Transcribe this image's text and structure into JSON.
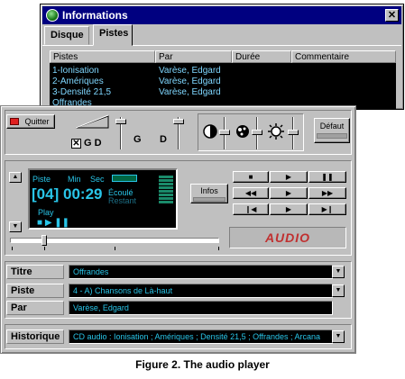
{
  "info_window": {
    "title": "Informations",
    "close_glyph": "✕",
    "tabs": [
      "Disque",
      "Pistes"
    ],
    "columns": [
      "Pistes",
      "Par",
      "Durée",
      "Commentaire"
    ],
    "rows": [
      {
        "piste": "1-Ionisation",
        "par": "Varèse, Edgard"
      },
      {
        "piste": "2-Amériques",
        "par": "Varèse, Edgard"
      },
      {
        "piste": "3-Densité 21,5",
        "par": "Varèse, Edgard"
      },
      {
        "piste": "Offrandes",
        "par": ""
      }
    ]
  },
  "controls": {
    "quit_label": "Quitter",
    "gd_label": "G D",
    "gd_checked": true,
    "check_glyph": "✕",
    "slider_g_label": "G",
    "slider_d_label": "D",
    "default_label": "Défaut"
  },
  "display": {
    "piste_label": "Piste",
    "min_label": "Min",
    "sec_label": "Sec",
    "track_number": "[04]",
    "time": "00:29",
    "ecoule_label": "Écoulé",
    "restant_label": "Restant",
    "play_label": "Play",
    "transport_glyphs": "■ ▶ ❚❚"
  },
  "infos_label": "Infos",
  "transport": {
    "row1": [
      "■",
      "▶",
      "❚❚"
    ],
    "row2": [
      "◀◀",
      "▶",
      "▶▶"
    ],
    "row3": [
      "❙◀",
      "▶",
      "▶❙"
    ]
  },
  "brand_text": "AUDIO",
  "scroll_up_glyph": "▲",
  "scroll_down_glyph": "▼",
  "fields": {
    "titre_label": "Titre",
    "titre_value": "Offrandes",
    "piste_label": "Piste",
    "piste_value": "4 - A) Chansons de Là-haut",
    "par_label": "Par",
    "par_value": "Varèse, Edgard",
    "historique_label": "Historique",
    "historique_value": "CD audio : Ionisation ; Amériques ; Densité 21,5 ; Offrandes ; Arcana",
    "dropdown_glyph": "▼"
  },
  "caption": "Figure 2. The audio player",
  "colors": {
    "display_text": "#29c5e8",
    "brand": "#c03030",
    "titlebar": "#000080"
  }
}
